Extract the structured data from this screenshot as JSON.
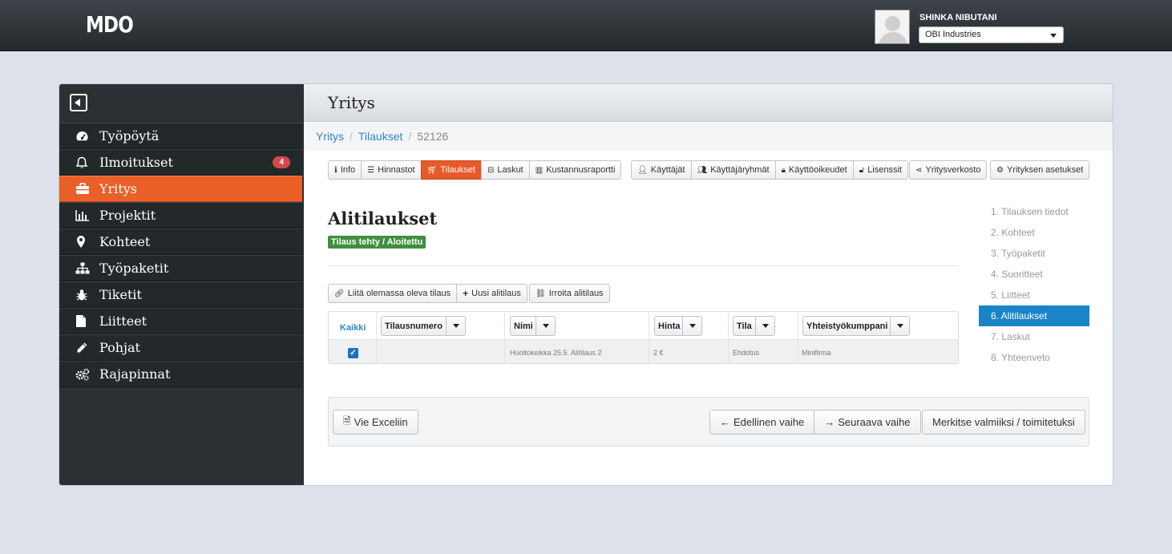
{
  "topbar": {
    "logo": "MDO",
    "user_name": "SHINKA NIBUTANI",
    "company": "OBI Industries"
  },
  "sidebar": {
    "items": [
      {
        "label": "Työpöytä",
        "icon": "dashboard-icon"
      },
      {
        "label": "Ilmoitukset",
        "icon": "bell-icon",
        "badge": "4"
      },
      {
        "label": "Yritys",
        "icon": "briefcase-icon",
        "active": true
      },
      {
        "label": "Projektit",
        "icon": "bar-chart-icon"
      },
      {
        "label": "Kohteet",
        "icon": "map-marker-icon"
      },
      {
        "label": "Työpaketit",
        "icon": "sitemap-icon"
      },
      {
        "label": "Tiketit",
        "icon": "bug-icon"
      },
      {
        "label": "Liitteet",
        "icon": "file-icon"
      },
      {
        "label": "Pohjat",
        "icon": "pencil-icon"
      },
      {
        "label": "Rajapinnat",
        "icon": "cogs-icon"
      }
    ]
  },
  "header": {
    "title": "Yritys"
  },
  "breadcrumb": {
    "items": [
      "Yritys",
      "Tilaukset",
      "52126"
    ]
  },
  "tabs": {
    "group1": [
      "Info",
      "Hinnastot",
      "Tilaukset",
      "Laskut",
      "Kustannusraportti"
    ],
    "group2": [
      "Käyttäjät",
      "Käyttäjäryhmät",
      "Käyttöoikeudet",
      "Lisenssit"
    ],
    "yritysverkosto": "Yritysverkosto",
    "asetukset": "Yrityksen asetukset",
    "active": "Tilaukset"
  },
  "main": {
    "title": "Alitilaukset",
    "status": "Tilaus tehty / Aloitettu",
    "actions": {
      "attach_existing": "Liitä olemassa oleva tilaus",
      "new_suborder": "Uusi alitilaus",
      "detach": "Irroita alitilaus"
    }
  },
  "grid": {
    "select_all": "Kaikki",
    "columns": [
      "Tilausnumero",
      "Nimi",
      "Hinta",
      "Tila",
      "Yhteistyökumppani"
    ],
    "rows": [
      {
        "checked": true,
        "tilausnumero": "",
        "nimi": "Huoltokeikka 25.5. Alitilaus 2",
        "hinta": "2 €",
        "tila": "Ehdotus",
        "kumppani": "Minifirma"
      }
    ]
  },
  "steps": {
    "items": [
      "1. Tilauksen tiedot",
      "2. Kohteet",
      "3. Työpaketit",
      "4. Suoritteet",
      "5. Liitteet",
      "6. Alitilaukset",
      "7. Laskut",
      "8. Yhteenveto"
    ],
    "active_index": 5
  },
  "footer": {
    "excel": "Vie Exceliin",
    "prev": "Edellinen vaihe",
    "next": "Seuraava vaihe",
    "mark_done": "Merkitse valmiiksi / toimitetuksi"
  }
}
